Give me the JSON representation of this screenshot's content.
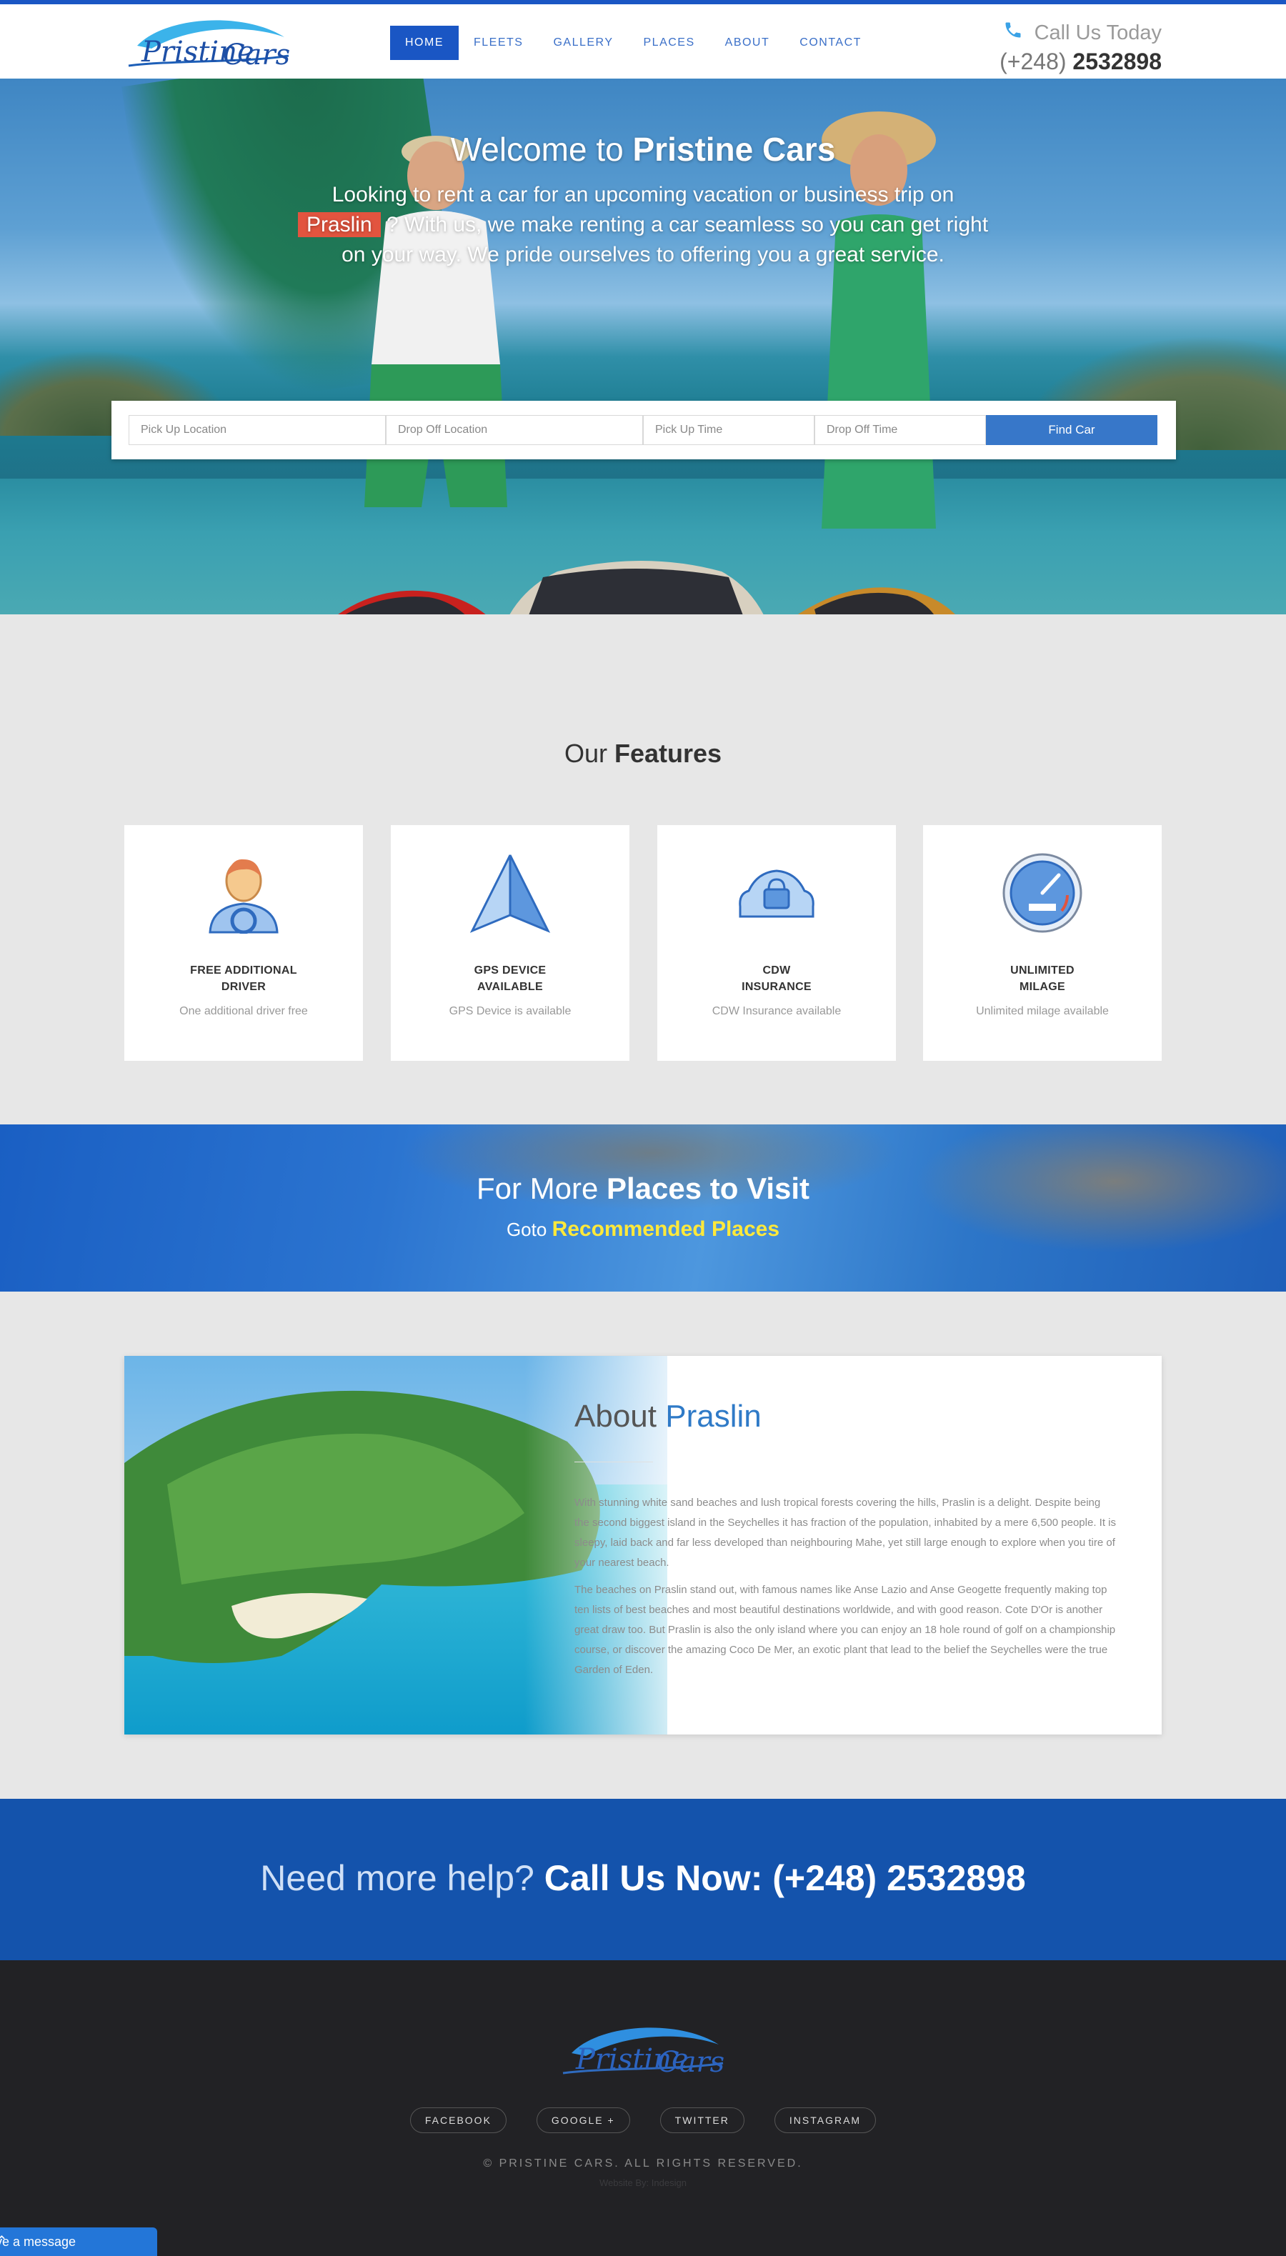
{
  "header": {
    "logo_text": "Pristine Cars",
    "nav": [
      "HOME",
      "FLEETS",
      "GALLERY",
      "PLACES",
      "ABOUT",
      "CONTACT"
    ],
    "call_label": "Call Us Today",
    "phone_prefix": "(+248)",
    "phone_number": "2532898"
  },
  "hero": {
    "title_light": "Welcome to",
    "title_bold": "Pristine Cars",
    "text_before": "Looking to rent a car for an upcoming vacation or business trip on",
    "highlight": "Praslin",
    "text_after": "? With us, we make renting a car seamless so you can get right on your way. We pride ourselves to offering you a great service."
  },
  "search": {
    "pickup_location": "Pick Up Location",
    "dropoff_location": "Drop Off Location",
    "pickup_time": "Pick Up Time",
    "dropoff_time": "Drop Off Time",
    "button": "Find Car"
  },
  "features": {
    "title_light": "Our",
    "title_bold": "Features",
    "items": [
      {
        "title_1": "FREE ADDITIONAL",
        "title_2": "DRIVER",
        "desc": "One additional driver free",
        "icon": "driver-icon"
      },
      {
        "title_1": "GPS DEVICE",
        "title_2": "AVAILABLE",
        "desc": "GPS Device is available",
        "icon": "gps-icon"
      },
      {
        "title_1": "CDW",
        "title_2": "INSURANCE",
        "desc": "CDW Insurance available",
        "icon": "car-lock-icon"
      },
      {
        "title_1": "UNLIMITED",
        "title_2": "MILAGE",
        "desc": "Unlimited milage available",
        "icon": "speedometer-icon"
      }
    ]
  },
  "places": {
    "title_light": "For More",
    "title_bold": "Places to Visit",
    "sub_light": "Goto",
    "sub_link": "Recommended Places"
  },
  "about": {
    "title_light": "About",
    "title_accent": "Praslin",
    "p1": "With stunning white sand beaches and lush tropical forests covering the hills, Praslin is a delight. Despite being the second biggest island in the Seychelles it has fraction of the population, inhabited by a mere 6,500 people. It is sleepy, laid back and far less developed than neighbouring Mahe, yet still large enough to explore when you tire of your nearest beach.",
    "p2": "The beaches on Praslin stand out, with famous names like Anse Lazio and Anse Geogette frequently making top ten lists of best beaches and most beautiful destinations worldwide, and with good reason. Cote D'Or is another great draw too. But Praslin is also the only island where you can enjoy an 18 hole round of golf on a championship course, or discover the amazing Coco De Mer, an exotic plant that lead to the belief the Seychelles were the true Garden of Eden."
  },
  "help": {
    "light": "Need more help?",
    "bold": "Call Us Now: (+248) 2532898"
  },
  "footer": {
    "social": [
      "FACEBOOK",
      "GOOGLE +",
      "TWITTER",
      "INSTAGRAM"
    ],
    "copyright": "© PRISTINE CARS. ALL RIGHTS RESERVED.",
    "credit": "Website By: Indesign"
  },
  "chat": {
    "label": "ve a message"
  },
  "colors": {
    "primary": "#1a56c4",
    "accent_red": "#e2543f",
    "link_yellow": "#ffe93a",
    "help_bg": "#1453ac",
    "footer_bg": "#222225"
  }
}
